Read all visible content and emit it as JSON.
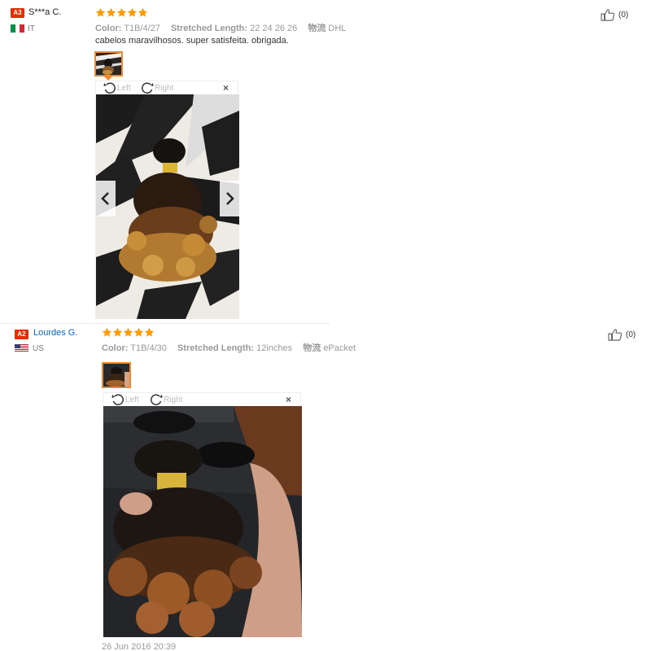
{
  "reviews": [
    {
      "badge": "A3",
      "username": "S***a C.",
      "country": "IT",
      "flag": "italy-flag",
      "rating": 5,
      "attrs": [
        {
          "key": "Color:",
          "value": "T1B/4/27"
        },
        {
          "key": "Stretched Length:",
          "value": "22 24 26 26"
        },
        {
          "key": "物流",
          "value": "DHL"
        }
      ],
      "comment": "cabelos maravilhosos. super satisfeita. obrigada.",
      "likes": "(0)",
      "viewer": {
        "left_label": "Left",
        "right_label": "Right",
        "close_label": "×"
      }
    },
    {
      "badge": "A2",
      "username": "Lourdes G.",
      "country": "US",
      "flag": "usa-flag",
      "rating": 5,
      "attrs": [
        {
          "key": "Color:",
          "value": "T1B/4/30"
        },
        {
          "key": "Stretched Length:",
          "value": "12inches"
        },
        {
          "key": "物流",
          "value": "ePacket"
        }
      ],
      "likes": "(0)",
      "viewer": {
        "left_label": "Left",
        "right_label": "Right",
        "close_label": "×"
      },
      "date": "26 Jun 2016 20:39"
    }
  ],
  "colors": {
    "badge": "#e62e04",
    "star": "#ff9a00",
    "thumb_border": "#f08a2c",
    "link": "#0066cc"
  }
}
